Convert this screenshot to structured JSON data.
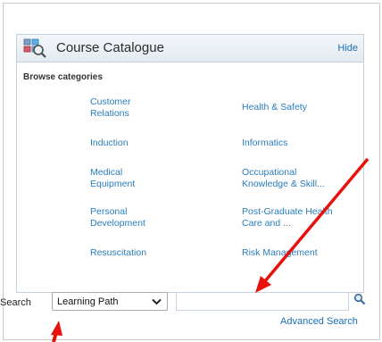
{
  "catalogue": {
    "title": "Course Catalogue",
    "hide_label": "Hide",
    "browse_label": "Browse categories",
    "categories": [
      {
        "label": "Customer\nRelations"
      },
      {
        "label": "Health & Safety"
      },
      {
        "label": "Induction"
      },
      {
        "label": "Informatics"
      },
      {
        "label": "Medical\nEquipment"
      },
      {
        "label": "Occupational\nKnowledge & Skill..."
      },
      {
        "label": "Personal\nDevelopment"
      },
      {
        "label": "Post-Graduate Health\nCare and ..."
      },
      {
        "label": "Resuscitation"
      },
      {
        "label": "Risk Management"
      }
    ]
  },
  "search": {
    "label": "Search",
    "type_value": "Learning Path",
    "input_value": "",
    "advanced_label": "Advanced Search"
  },
  "colors": {
    "link": "#1a6fb3",
    "category": "#2a7dbb",
    "annotation_arrow": "#e8120c"
  }
}
